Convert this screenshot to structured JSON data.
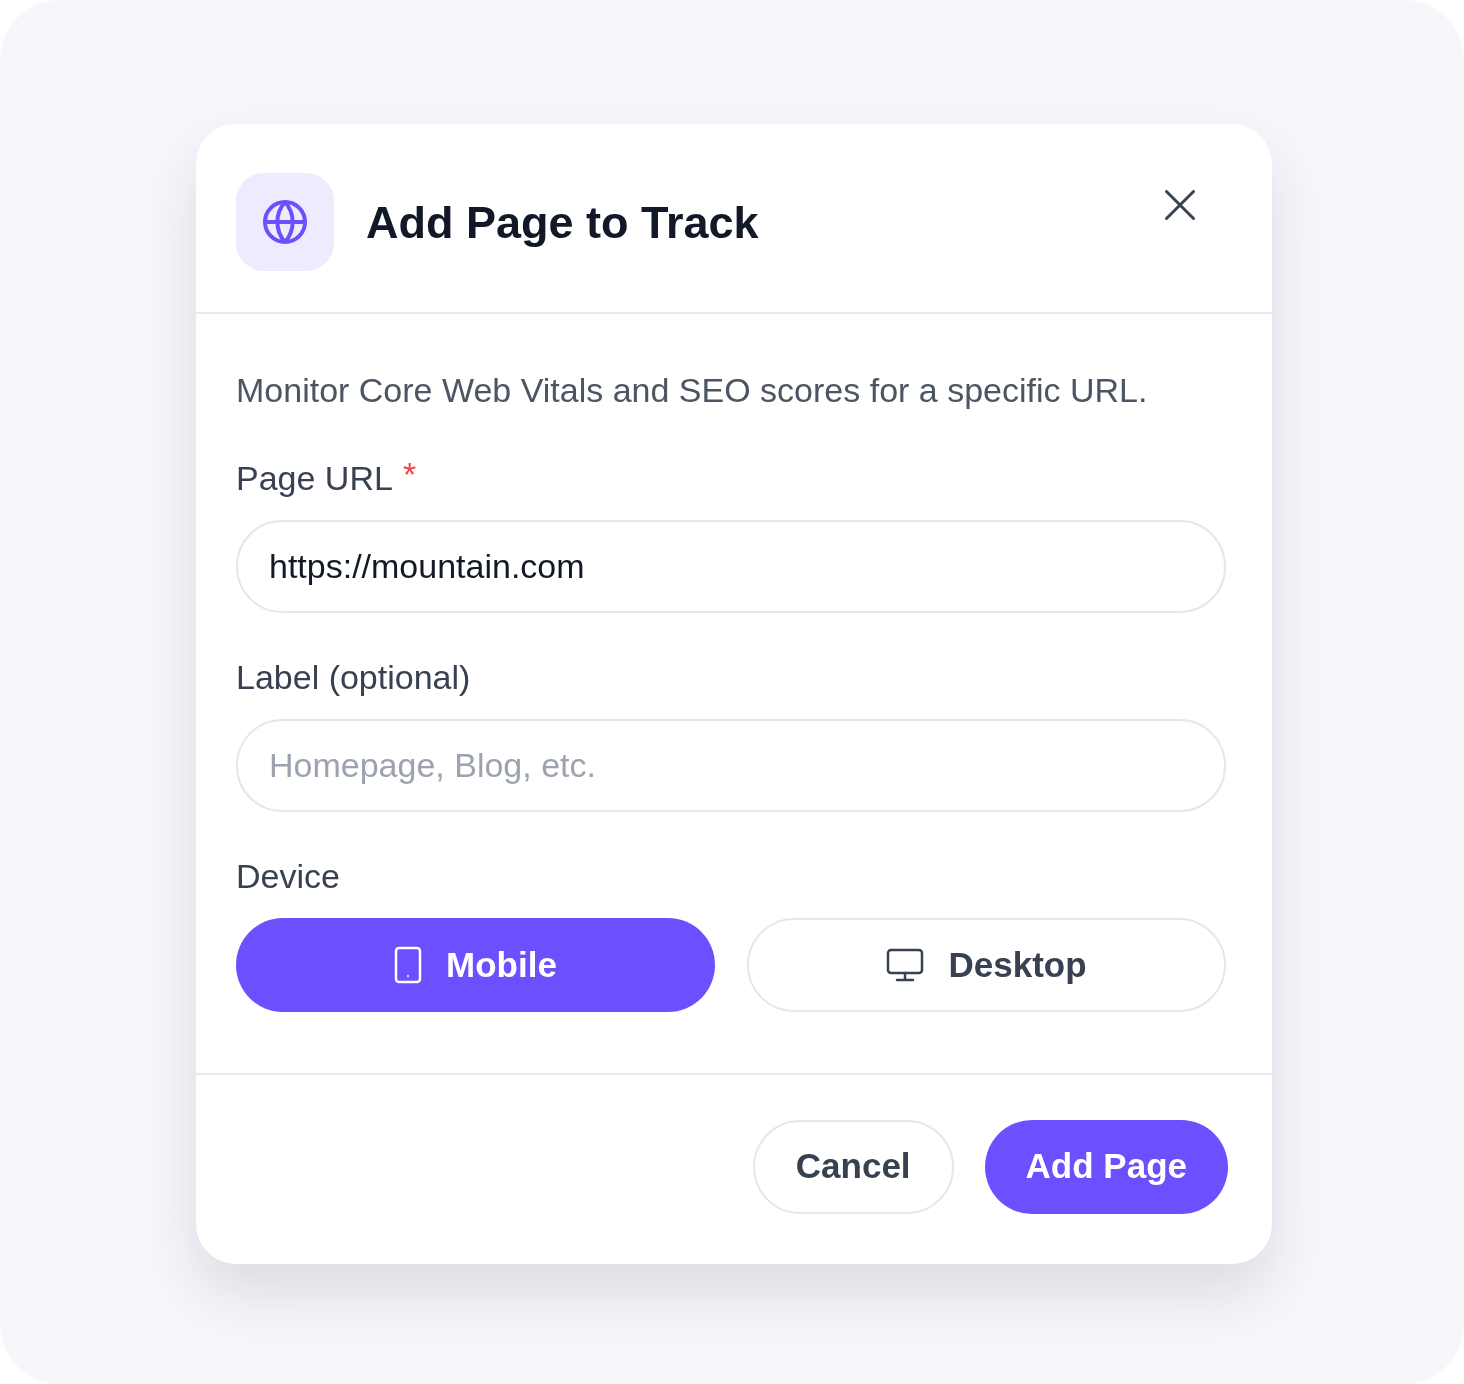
{
  "dialog": {
    "title": "Add Page to Track",
    "description": "Monitor Core Web Vitals and SEO scores for a specific URL.",
    "fields": [
      {
        "label": "Page URL",
        "required_mark": "*",
        "value": "https://mountain.com"
      },
      {
        "label": "Label (optional)",
        "placeholder": "Homepage, Blog, etc."
      }
    ],
    "device": {
      "label": "Device",
      "options": [
        {
          "label": "Mobile",
          "kind": "mobile",
          "selected": true
        },
        {
          "label": "Desktop",
          "kind": "desktop",
          "selected": false
        }
      ]
    },
    "buttons": [
      {
        "label": "Cancel",
        "kind": "secondary"
      },
      {
        "label": "Add Page",
        "kind": "primary"
      }
    ]
  }
}
